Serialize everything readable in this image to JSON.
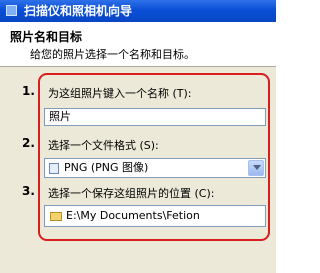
{
  "window": {
    "title": "扫描仪和照相机向导"
  },
  "header": {
    "title": "照片名和目标",
    "subtitle": "给您的照片选择一个名称和目标。"
  },
  "steps": [
    {
      "number": "1.",
      "label": "为这组照片键入一个名称 (T):"
    },
    {
      "number": "2.",
      "label": "选择一个文件格式 (S):"
    },
    {
      "number": "3.",
      "label": "选择一个保存这组照片的位置 (C):"
    }
  ],
  "name_field": {
    "value": "照片"
  },
  "format_select": {
    "selected": "PNG (PNG 图像)",
    "icon": "image-file-icon"
  },
  "location_select": {
    "selected": "E:\\My Documents\\Fetion",
    "icon": "folder-icon"
  },
  "colors": {
    "highlight": "#d81e1e",
    "titlebar": "#0a4fd6",
    "panel": "#ece9d8"
  }
}
